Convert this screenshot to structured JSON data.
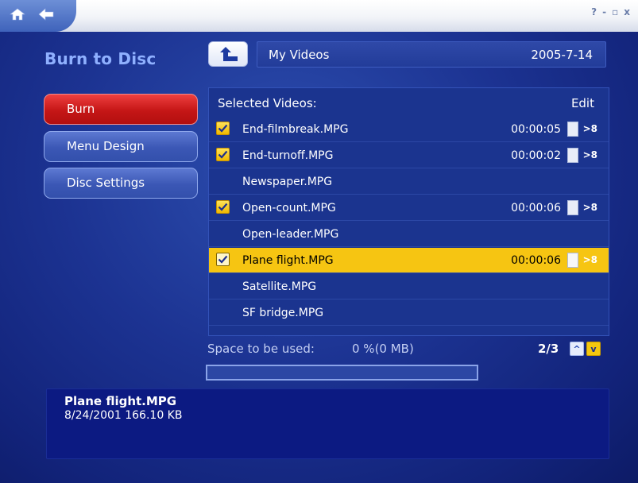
{
  "window": {
    "controls": [
      "?",
      "-",
      "▫",
      "x"
    ]
  },
  "page": {
    "title": "Burn to Disc"
  },
  "menu": {
    "items": [
      {
        "label": "Burn",
        "active": true
      },
      {
        "label": "Menu Design",
        "active": false
      },
      {
        "label": "Disc Settings",
        "active": false
      }
    ]
  },
  "path": {
    "folder": "My Videos",
    "date": "2005-7-14"
  },
  "list": {
    "heading": "Selected Videos:",
    "edit_label": "Edit",
    "rows": [
      {
        "name": "End-filmbreak.MPG",
        "checked": true,
        "duration": "00:00:05",
        "highlighted": false
      },
      {
        "name": "End-turnoff.MPG",
        "checked": true,
        "duration": "00:00:02",
        "highlighted": false
      },
      {
        "name": "Newspaper.MPG",
        "checked": false,
        "duration": "",
        "highlighted": false
      },
      {
        "name": "Open-count.MPG",
        "checked": true,
        "duration": "00:00:06",
        "highlighted": false
      },
      {
        "name": "Open-leader.MPG",
        "checked": false,
        "duration": "",
        "highlighted": false
      },
      {
        "name": "Plane flight.MPG",
        "checked": true,
        "duration": "00:00:06",
        "highlighted": true
      },
      {
        "name": "Satellite.MPG",
        "checked": false,
        "duration": "",
        "highlighted": false
      },
      {
        "name": "SF bridge.MPG",
        "checked": false,
        "duration": "",
        "highlighted": false
      }
    ],
    "trim_glyph": ">8"
  },
  "space": {
    "label": "Space to be used:",
    "value": "0 %(0 MB)",
    "fill_fraction": 0.0
  },
  "pager": {
    "indicator": "2/3",
    "up_glyph": "^",
    "down_glyph": "v"
  },
  "info": {
    "name": "Plane flight.MPG",
    "meta": "8/24/2001  166.10 KB"
  },
  "colors": {
    "accent_red": "#d21a1a",
    "highlight_yellow": "#f6c512",
    "background_blue": "#1c3392"
  }
}
